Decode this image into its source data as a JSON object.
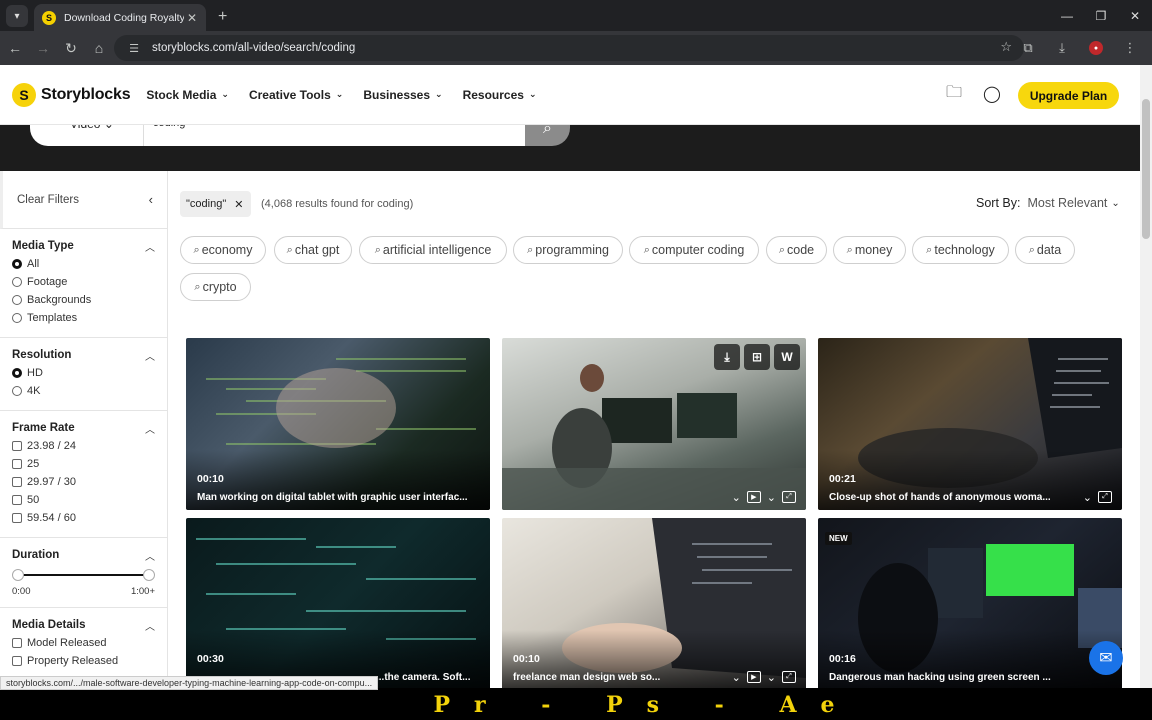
{
  "browser": {
    "tab_title": "Download Coding Royalty-Free",
    "tab_favicon": "S",
    "url": "storyblocks.com/all-video/search/coding",
    "status_url": "storyblocks.com/.../male-software-developer-typing-machine-learning-app-code-on-compu..."
  },
  "header": {
    "logo_mark": "S",
    "logo_text": "Storyblocks",
    "nav": [
      {
        "label": "Stock Media"
      },
      {
        "label": "Creative Tools"
      },
      {
        "label": "Businesses"
      },
      {
        "label": "Resources"
      }
    ],
    "upgrade_label": "Upgrade Plan"
  },
  "search": {
    "type_label": "Video",
    "query": "coding"
  },
  "sidebar": {
    "clear_filters": "Clear Filters",
    "media_type": {
      "title": "Media Type",
      "options": [
        "All",
        "Footage",
        "Backgrounds",
        "Templates"
      ],
      "selected": "All"
    },
    "resolution": {
      "title": "Resolution",
      "options": [
        "HD",
        "4K"
      ],
      "selected": "HD"
    },
    "frame_rate": {
      "title": "Frame Rate",
      "options": [
        "23.98 / 24",
        "25",
        "29.97 / 30",
        "50",
        "59.54 / 60"
      ]
    },
    "duration": {
      "title": "Duration",
      "min_label": "0:00",
      "max_label": "1:00+"
    },
    "media_details": {
      "title": "Media Details",
      "options": [
        "Model Released",
        "Property Released"
      ]
    }
  },
  "results": {
    "active_filter": "\"coding\"",
    "count_text": "(4,068 results found for coding)",
    "sort_label": "Sort By:",
    "sort_value": "Most Relevant",
    "tags": [
      "economy",
      "chat gpt",
      "artificial intelligence",
      "programming",
      "computer coding",
      "code",
      "money",
      "technology",
      "data",
      "crypto"
    ],
    "cards": [
      {
        "duration": "00:10",
        "title": "Man working on digital tablet with graphic user interfac..."
      },
      {
        "duration": "",
        "title": ""
      },
      {
        "duration": "00:21",
        "title": "Close-up shot of hands of anonymous woma..."
      },
      {
        "duration": "00:30",
        "title": "...the camera. Soft..."
      },
      {
        "duration": "00:10",
        "title": "freelance man design web so..."
      },
      {
        "duration": "00:16",
        "title": "Dangerous man hacking using green screen ...",
        "badge": "NEW"
      }
    ]
  },
  "caption": "Pr - Ps - Ae",
  "colors": {
    "accent": "#f7d70d",
    "dark_band": "#1c1c1c",
    "chat": "#1a73e8"
  }
}
